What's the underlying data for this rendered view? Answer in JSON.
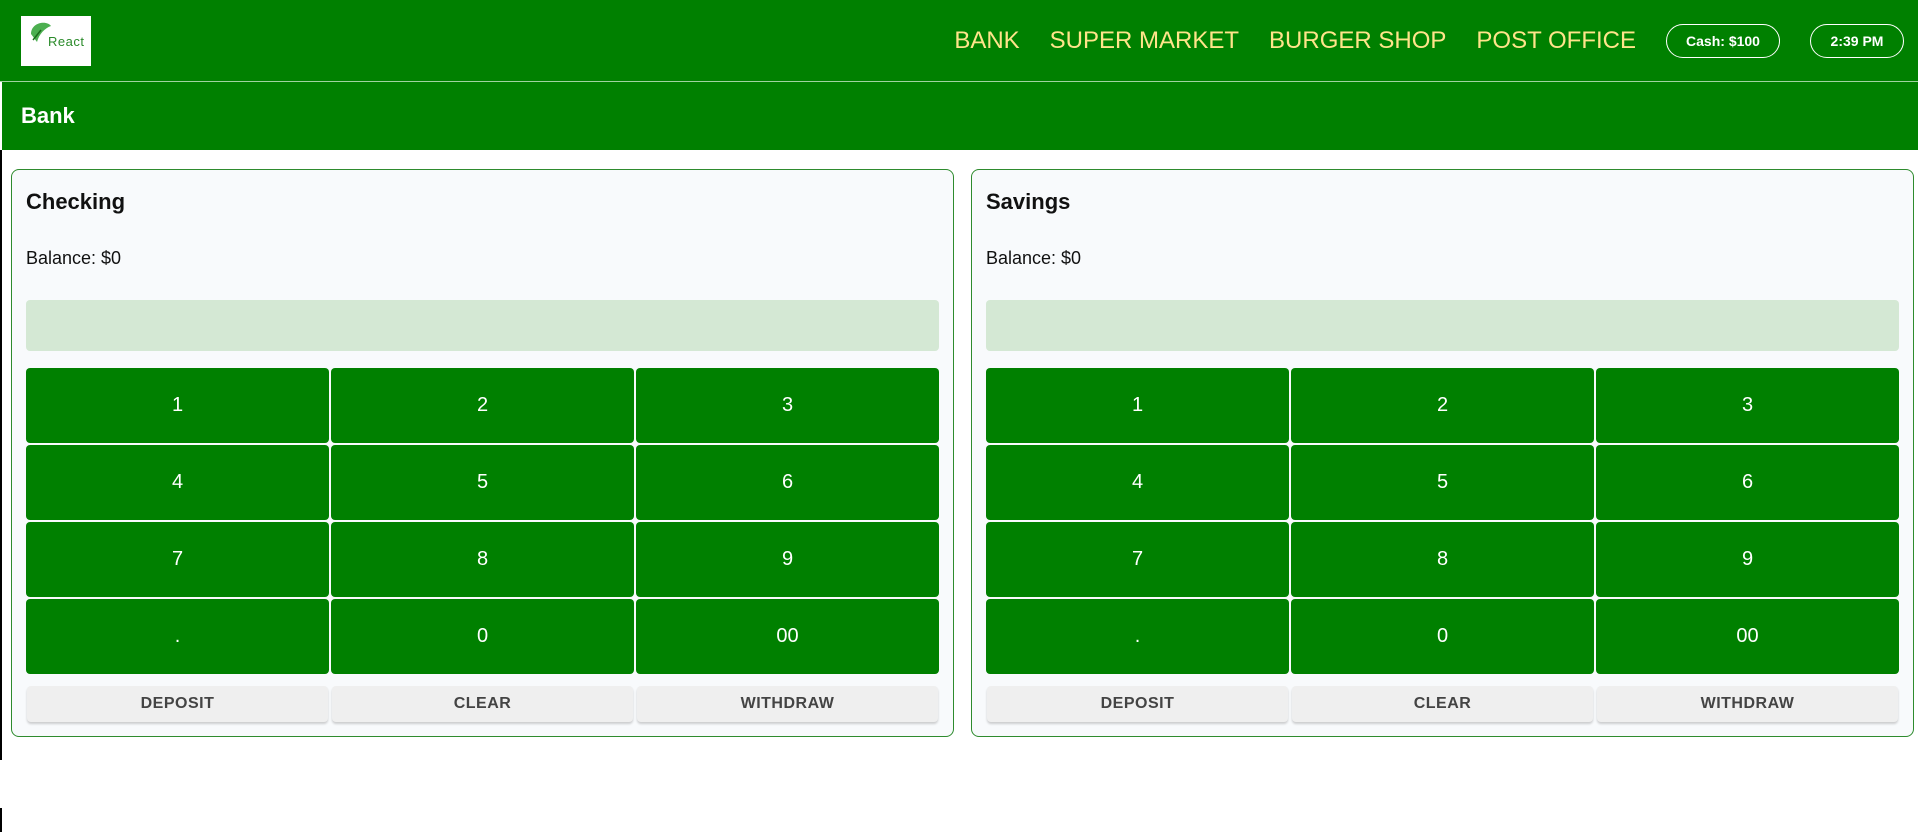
{
  "app": {
    "logo_text": "React",
    "nav": [
      "BANK",
      "SUPER MARKET",
      "BURGER SHOP",
      "POST OFFICE"
    ],
    "cash": "Cash: $100",
    "time": "2:39 PM"
  },
  "section": {
    "title": "Bank"
  },
  "accounts": [
    {
      "title": "Checking",
      "balance": "Balance: $0",
      "display_value": "",
      "keys": [
        "1",
        "2",
        "3",
        "4",
        "5",
        "6",
        "7",
        "8",
        "9",
        ".",
        "0",
        "00"
      ],
      "actions": [
        "DEPOSIT",
        "CLEAR",
        "WITHDRAW"
      ]
    },
    {
      "title": "Savings",
      "balance": "Balance: $0",
      "display_value": "",
      "keys": [
        "1",
        "2",
        "3",
        "4",
        "5",
        "6",
        "7",
        "8",
        "9",
        ".",
        "0",
        "00"
      ],
      "actions": [
        "DEPOSIT",
        "CLEAR",
        "WITHDRAW"
      ]
    }
  ],
  "colors": {
    "primary": "#008000",
    "nav_link": "#ffe48a",
    "display_bg": "#d4e8d4",
    "panel_bg": "#f8fafc",
    "action_bg": "#efefef"
  }
}
